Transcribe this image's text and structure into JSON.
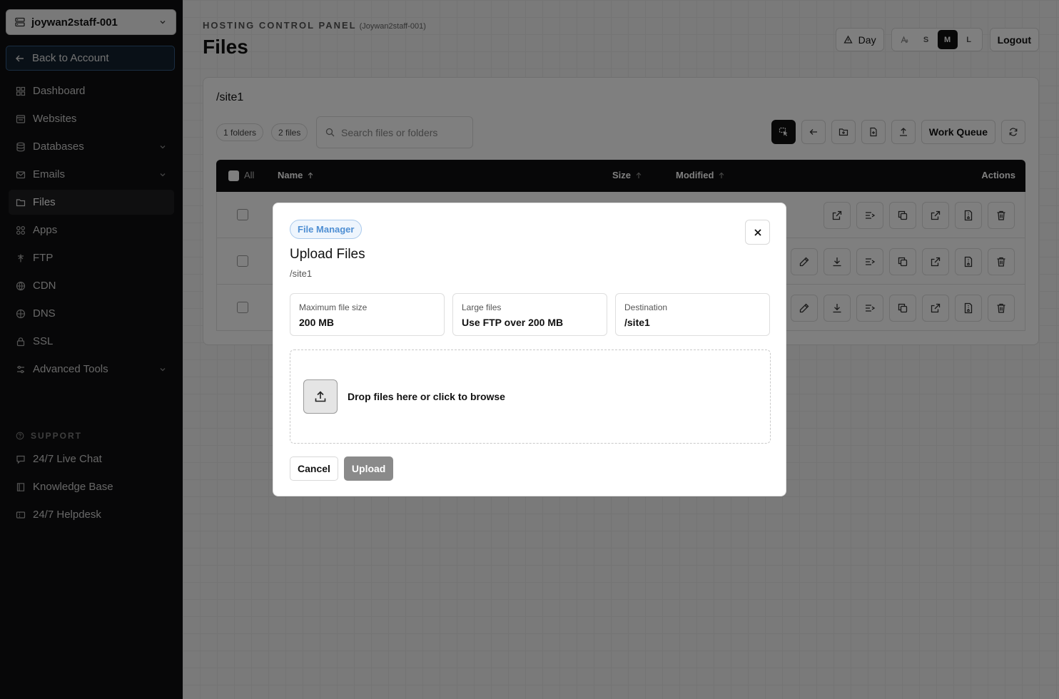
{
  "sidebar": {
    "account": "joywan2staff-001",
    "back_label": "Back to Account",
    "items": [
      {
        "label": "Dashboard"
      },
      {
        "label": "Websites"
      },
      {
        "label": "Databases"
      },
      {
        "label": "Emails"
      },
      {
        "label": "Files"
      },
      {
        "label": "Apps"
      },
      {
        "label": "FTP"
      },
      {
        "label": "CDN"
      },
      {
        "label": "DNS"
      },
      {
        "label": "SSL"
      },
      {
        "label": "Advanced Tools"
      }
    ],
    "support_title": "SUPPORT",
    "support_items": [
      {
        "label": "24/7 Live Chat"
      },
      {
        "label": "Knowledge Base"
      },
      {
        "label": "24/7 Helpdesk"
      }
    ]
  },
  "header": {
    "eyebrow": "HOSTING CONTROL PANEL",
    "eyebrow_sub": "(Joywan2staff-001)",
    "title": "Files",
    "theme_label": "Day",
    "sizes": [
      "S",
      "M",
      "L"
    ],
    "active_size": "M",
    "logout_label": "Logout"
  },
  "files": {
    "path": "/site1",
    "folders_count": "1 folders",
    "files_count": "2 files",
    "search_placeholder": "Search files or folders",
    "work_queue_label": "Work Queue",
    "table": {
      "all_label": "All",
      "columns": {
        "name": "Name",
        "size": "Size",
        "modified": "Modified",
        "actions": "Actions"
      }
    }
  },
  "modal": {
    "badge": "File Manager",
    "title": "Upload Files",
    "path": "/site1",
    "cards": [
      {
        "label": "Maximum file size",
        "value": "200 MB"
      },
      {
        "label": "Large files",
        "value": "Use FTP over 200 MB"
      },
      {
        "label": "Destination",
        "value": "/site1"
      }
    ],
    "dropzone_text": "Drop files here or click to browse",
    "cancel_label": "Cancel",
    "upload_label": "Upload"
  }
}
